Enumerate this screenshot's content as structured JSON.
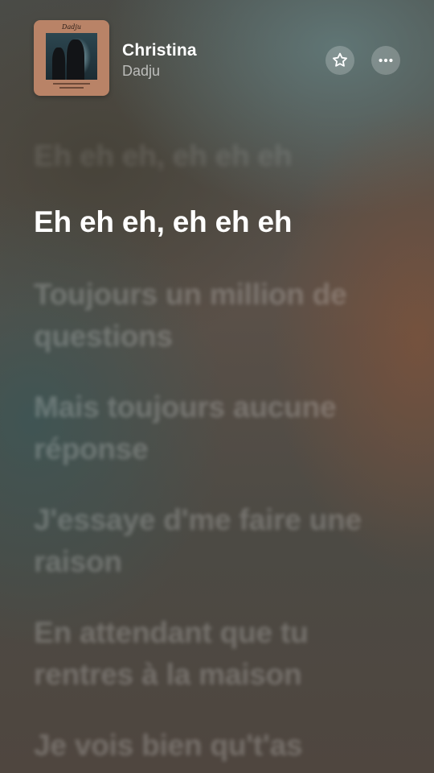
{
  "track": {
    "title": "Christina",
    "artist": "Dadju",
    "artwork_icon": "album-artwork"
  },
  "actions": {
    "favorite_icon": "star-icon",
    "more_icon": "ellipsis-icon"
  },
  "lyrics": {
    "previous": "Eh eh eh, eh eh eh",
    "current": "Eh eh eh, eh eh eh",
    "upcoming": [
      "Toujours un million de questions",
      "Mais toujours aucune réponse",
      "J'essaye d'me faire une raison",
      "En attendant que tu rentres à la maison",
      "Je vois bien qu't'as"
    ]
  },
  "colors": {
    "active_lyric": "#ffffff",
    "inactive_lyric": "rgba(255,255,255,0.22)"
  }
}
